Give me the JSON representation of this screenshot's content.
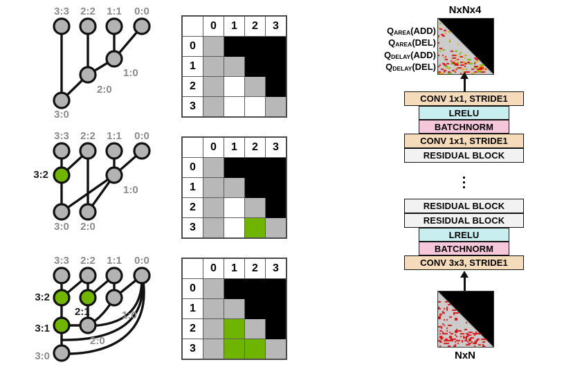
{
  "diagram": {
    "title_top_right": "NxNx4",
    "title_bottom_right": "NxN"
  },
  "graphs": [
    {
      "name": "graph-step-0",
      "top_labels": [
        "3:3",
        "2:2",
        "1:1",
        "0:0"
      ],
      "inner_labels": [
        "1:0",
        "2:0",
        "3:0"
      ],
      "highlighted_labels": []
    },
    {
      "name": "graph-step-1",
      "top_labels": [
        "3:3",
        "2:2",
        "1:1",
        "0:0"
      ],
      "inner_labels": [
        "1:0",
        "3:0",
        "2:0"
      ],
      "highlighted_labels": [
        "3:2"
      ]
    },
    {
      "name": "graph-step-2",
      "top_labels": [
        "3:3",
        "2:2",
        "1:1",
        "0:0"
      ],
      "inner_labels": [
        "1:0",
        "2:0",
        "3:0"
      ],
      "highlighted_labels": [
        "3:2",
        "2:1",
        "3:1"
      ]
    }
  ],
  "matrices": [
    {
      "name": "adjacency-matrix-0",
      "col_headers": [
        "0",
        "1",
        "2",
        "3"
      ],
      "row_headers": [
        "0",
        "1",
        "2",
        "3"
      ],
      "cells": [
        [
          "gray",
          "black",
          "black",
          "black"
        ],
        [
          "gray",
          "gray",
          "black",
          "black"
        ],
        [
          "gray",
          "white",
          "gray",
          "black"
        ],
        [
          "gray",
          "white",
          "white",
          "gray"
        ]
      ]
    },
    {
      "name": "adjacency-matrix-1",
      "col_headers": [
        "0",
        "1",
        "2",
        "3"
      ],
      "row_headers": [
        "0",
        "1",
        "2",
        "3"
      ],
      "cells": [
        [
          "gray",
          "black",
          "black",
          "black"
        ],
        [
          "gray",
          "gray",
          "black",
          "black"
        ],
        [
          "gray",
          "white",
          "gray",
          "black"
        ],
        [
          "gray",
          "white",
          "green",
          "gray"
        ]
      ]
    },
    {
      "name": "adjacency-matrix-2",
      "col_headers": [
        "0",
        "1",
        "2",
        "3"
      ],
      "row_headers": [
        "0",
        "1",
        "2",
        "3"
      ],
      "cells": [
        [
          "gray",
          "black",
          "black",
          "black"
        ],
        [
          "gray",
          "gray",
          "black",
          "black"
        ],
        [
          "gray",
          "green",
          "gray",
          "black"
        ],
        [
          "gray",
          "green",
          "green",
          "gray"
        ]
      ]
    }
  ],
  "network": {
    "output_label": "NxNx4",
    "input_label": "NxN",
    "q_labels": [
      {
        "base": "Q",
        "sub": "AREA",
        "tail": "(ADD)"
      },
      {
        "base": "Q",
        "sub": "AREA",
        "tail": "(DEL)"
      },
      {
        "base": "Q",
        "sub": "DELAY",
        "tail": "(ADD)"
      },
      {
        "base": "Q",
        "sub": "DELAY",
        "tail": "(DEL)"
      }
    ],
    "layers": [
      {
        "label": "CONV 1x1, STRIDE1",
        "kind": "conv"
      },
      {
        "label": "LRELU",
        "kind": "lrelu"
      },
      {
        "label": "BATCHNORM",
        "kind": "bn"
      },
      {
        "label": "CONV 1x1, STRIDE1",
        "kind": "conv"
      },
      {
        "label": "RESIDUAL BLOCK",
        "kind": "res"
      },
      {
        "label": "RESIDUAL BLOCK",
        "kind": "res"
      },
      {
        "label": "RESIDUAL BLOCK",
        "kind": "res"
      },
      {
        "label": "LRELU",
        "kind": "lrelu"
      },
      {
        "label": "BATCHNORM",
        "kind": "bn"
      },
      {
        "label": "CONV 3x3, STRIDE1",
        "kind": "conv"
      }
    ]
  },
  "colors": {
    "green": "#6fb500",
    "gray_node": "#b3b3b3",
    "conv": "#f6dbbb",
    "lrelu": "#c9eef0",
    "batchnorm": "#f6c7da",
    "residual": "#f2f2f2",
    "black": "#000000"
  }
}
